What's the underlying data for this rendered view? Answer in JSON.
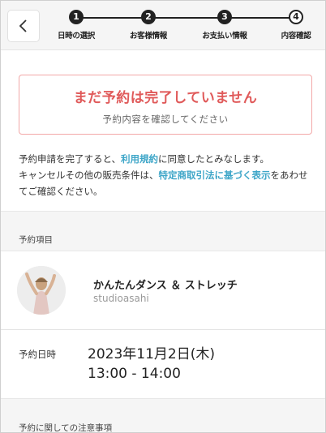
{
  "header": {
    "steps": [
      {
        "num": "1",
        "label": "日時の選択"
      },
      {
        "num": "2",
        "label": "お客様情報"
      },
      {
        "num": "3",
        "label": "お支払い情報"
      },
      {
        "num": "4",
        "label": "内容確認"
      }
    ]
  },
  "alert": {
    "title": "まだ予約は完了していません",
    "subtitle": "予約内容を確認してください"
  },
  "notice": {
    "part1": "予約申請を完了すると、",
    "link1": "利用規約",
    "part2": "に同意したとみなします。",
    "part3": "キャンセルその他の販売条件は、",
    "link2": "特定商取引法に基づく表示",
    "part4": "をあわせてご確認ください。"
  },
  "sections": {
    "reservation_item": "予約項目",
    "notes": "予約に関しての注意事項"
  },
  "item": {
    "title": "かんたんダンス ＆ ストレッチ",
    "studio": "studioasahi"
  },
  "schedule": {
    "label": "予約日時",
    "date": "2023年11月2日(木)",
    "time": "13:00 - 14:00"
  },
  "colors": {
    "alert_text": "#e05a5a",
    "alert_border": "#f2a8a8",
    "link": "#3ea6c8"
  }
}
